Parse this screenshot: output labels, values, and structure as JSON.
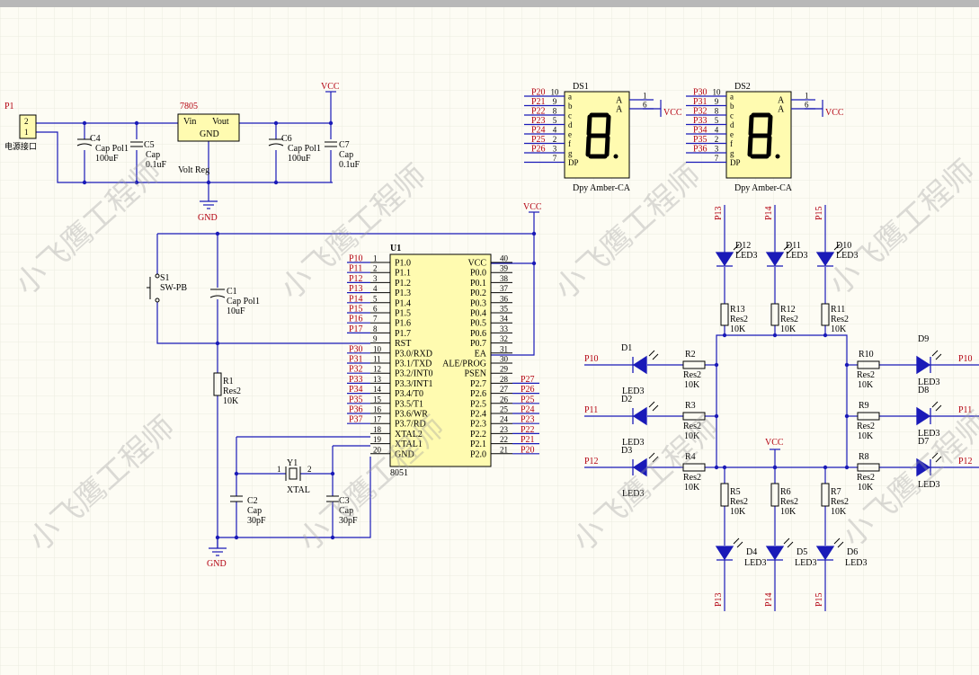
{
  "watermark": "小飞鹰工程师",
  "colors": {
    "wire": "#1a1ab8",
    "net": "#b3000f",
    "part": "#fffbb0",
    "grid": "#ecebe0",
    "led": "#1a1ab8"
  },
  "power": {
    "p1": {
      "ref": "P1",
      "pin2": "2",
      "pin1": "1",
      "name": "电源接口"
    },
    "reg": {
      "ref": "7805",
      "vin": "Vin",
      "vout": "Vout",
      "gnd": "GND",
      "desc": "Volt Reg"
    },
    "c4": {
      "ref": "C4",
      "type": "Cap Pol1",
      "value": "100uF"
    },
    "c5": {
      "ref": "C5",
      "type": "Cap",
      "value": "0.1uF"
    },
    "c6": {
      "ref": "C6",
      "type": "Cap Pol1",
      "value": "100uF"
    },
    "c7": {
      "ref": "C7",
      "type": "Cap",
      "value": "0.1uF"
    },
    "vcc": "VCC",
    "gnd": "GND"
  },
  "reset": {
    "s1": "S1",
    "s1_type": "SW-PB",
    "c1": "C1",
    "c1_type": "Cap Pol1",
    "c1_value": "10uF",
    "r1": "R1",
    "r1_type": "Res2",
    "r1_value": "10K"
  },
  "crystal": {
    "y1": "Y1",
    "y1_type": "XTAL",
    "pin1": "1",
    "pin2": "2",
    "c2": "C2",
    "c3": "C3",
    "c_type": "Cap",
    "c_value": "30pF",
    "gnd": "GND"
  },
  "mcu": {
    "ref": "U1",
    "part": "8051",
    "vcc": "VCC",
    "left": [
      {
        "net": "P10",
        "num": "1",
        "name": "P1.0"
      },
      {
        "net": "P11",
        "num": "2",
        "name": "P1.1"
      },
      {
        "net": "P12",
        "num": "3",
        "name": "P1.2"
      },
      {
        "net": "P13",
        "num": "4",
        "name": "P1.3"
      },
      {
        "net": "P14",
        "num": "5",
        "name": "P1.4"
      },
      {
        "net": "P15",
        "num": "6",
        "name": "P1.5"
      },
      {
        "net": "P16",
        "num": "7",
        "name": "P1.6"
      },
      {
        "net": "P17",
        "num": "8",
        "name": "P1.7"
      },
      {
        "net": "",
        "num": "9",
        "name": "RST"
      },
      {
        "net": "P30",
        "num": "10",
        "name": "P3.0/RXD"
      },
      {
        "net": "P31",
        "num": "11",
        "name": "P3.1/TXD"
      },
      {
        "net": "P32",
        "num": "12",
        "name": "P3.2/INT0"
      },
      {
        "net": "P33",
        "num": "13",
        "name": "P3.3/INT1"
      },
      {
        "net": "P34",
        "num": "14",
        "name": "P3.4/T0"
      },
      {
        "net": "P35",
        "num": "15",
        "name": "P3.5/T1"
      },
      {
        "net": "P36",
        "num": "16",
        "name": "P3.6/WR"
      },
      {
        "net": "P37",
        "num": "17",
        "name": "P3.7/RD"
      },
      {
        "net": "",
        "num": "18",
        "name": "XTAL2"
      },
      {
        "net": "",
        "num": "19",
        "name": "XTAL1"
      },
      {
        "net": "",
        "num": "20",
        "name": "GND"
      }
    ],
    "right": [
      {
        "net": "",
        "num": "40",
        "name": "VCC"
      },
      {
        "net": "",
        "num": "39",
        "name": "P0.0"
      },
      {
        "net": "",
        "num": "38",
        "name": "P0.1"
      },
      {
        "net": "",
        "num": "37",
        "name": "P0.2"
      },
      {
        "net": "",
        "num": "36",
        "name": "P0.3"
      },
      {
        "net": "",
        "num": "35",
        "name": "P0.4"
      },
      {
        "net": "",
        "num": "34",
        "name": "P0.5"
      },
      {
        "net": "",
        "num": "33",
        "name": "P0.6"
      },
      {
        "net": "",
        "num": "32",
        "name": "P0.7"
      },
      {
        "net": "",
        "num": "31",
        "name": "EA"
      },
      {
        "net": "",
        "num": "30",
        "name": "ALE/PROG"
      },
      {
        "net": "",
        "num": "29",
        "name": "PSEN"
      },
      {
        "net": "P27",
        "num": "28",
        "name": "P2.7"
      },
      {
        "net": "P26",
        "num": "27",
        "name": "P2.6"
      },
      {
        "net": "P25",
        "num": "26",
        "name": "P2.5"
      },
      {
        "net": "P24",
        "num": "25",
        "name": "P2.4"
      },
      {
        "net": "P23",
        "num": "24",
        "name": "P2.3"
      },
      {
        "net": "P22",
        "num": "23",
        "name": "P2.2"
      },
      {
        "net": "P21",
        "num": "22",
        "name": "P2.1"
      },
      {
        "net": "P20",
        "num": "21",
        "name": "P2.0"
      }
    ]
  },
  "displays": [
    {
      "ref": "DS1",
      "part": "Dpy Amber-CA",
      "vcc": "VCC",
      "pins": [
        {
          "net": "P20",
          "num": "10",
          "seg": "a"
        },
        {
          "net": "P21",
          "num": "9",
          "seg": "b"
        },
        {
          "net": "P22",
          "num": "8",
          "seg": "c"
        },
        {
          "net": "P23",
          "num": "5",
          "seg": "d"
        },
        {
          "net": "P24",
          "num": "4",
          "seg": "e"
        },
        {
          "net": "P25",
          "num": "2",
          "seg": "f"
        },
        {
          "net": "P26",
          "num": "3",
          "seg": "g"
        },
        {
          "net": "",
          "num": "7",
          "seg": "DP"
        }
      ],
      "anodes": [
        {
          "num": "1",
          "name": "A"
        },
        {
          "num": "6",
          "name": "A"
        }
      ]
    },
    {
      "ref": "DS2",
      "part": "Dpy Amber-CA",
      "vcc": "VCC",
      "pins": [
        {
          "net": "P30",
          "num": "10",
          "seg": "a"
        },
        {
          "net": "P31",
          "num": "9",
          "seg": "b"
        },
        {
          "net": "P32",
          "num": "8",
          "seg": "c"
        },
        {
          "net": "P33",
          "num": "5",
          "seg": "d"
        },
        {
          "net": "P34",
          "num": "4",
          "seg": "e"
        },
        {
          "net": "P35",
          "num": "2",
          "seg": "f"
        },
        {
          "net": "P36",
          "num": "3",
          "seg": "g"
        },
        {
          "net": "",
          "num": "7",
          "seg": "DP"
        }
      ],
      "anodes": [
        {
          "num": "1",
          "name": "A"
        },
        {
          "num": "6",
          "name": "A"
        }
      ]
    }
  ],
  "leds": {
    "top": [
      {
        "ref": "D12",
        "part": "LED3",
        "net": "P13",
        "res": "R13",
        "res_type": "Res2",
        "res_value": "10K"
      },
      {
        "ref": "D11",
        "part": "LED3",
        "net": "P14",
        "res": "R12",
        "res_type": "Res2",
        "res_value": "10K"
      },
      {
        "ref": "D10",
        "part": "LED3",
        "net": "P15",
        "res": "R11",
        "res_type": "Res2",
        "res_value": "10K"
      }
    ],
    "left": [
      {
        "ref": "D1",
        "part": "LED3",
        "net": "P10",
        "res": "R2",
        "res_type": "Res2",
        "res_value": "10K"
      },
      {
        "ref": "D2",
        "part": "LED3",
        "net": "P11",
        "res": "R3",
        "res_type": "Res2",
        "res_value": "10K"
      },
      {
        "ref": "D3",
        "part": "LED3",
        "net": "P12",
        "res": "R4",
        "res_type": "Res2",
        "res_value": "10K"
      }
    ],
    "right": [
      {
        "ref": "D9",
        "part": "LED3",
        "net": "P10",
        "res": "R10",
        "res_type": "Res2",
        "res_value": "10K"
      },
      {
        "ref": "D8",
        "part": "LED3",
        "net": "P11",
        "res": "R9",
        "res_type": "Res2",
        "res_value": "10K"
      },
      {
        "ref": "D7",
        "part": "LED3",
        "net": "P12",
        "res": "R8",
        "res_type": "Res2",
        "res_value": "10K"
      }
    ],
    "bottom": [
      {
        "ref": "D4",
        "part": "LED3",
        "net": "P13",
        "res": "R5",
        "res_type": "Res2",
        "res_value": "10K"
      },
      {
        "ref": "D5",
        "part": "LED3",
        "net": "P14",
        "res": "R6",
        "res_type": "Res2",
        "res_value": "10K"
      },
      {
        "ref": "D6",
        "part": "LED3",
        "net": "P15",
        "res": "R7",
        "res_type": "Res2",
        "res_value": "10K"
      }
    ],
    "vcc": "VCC"
  }
}
